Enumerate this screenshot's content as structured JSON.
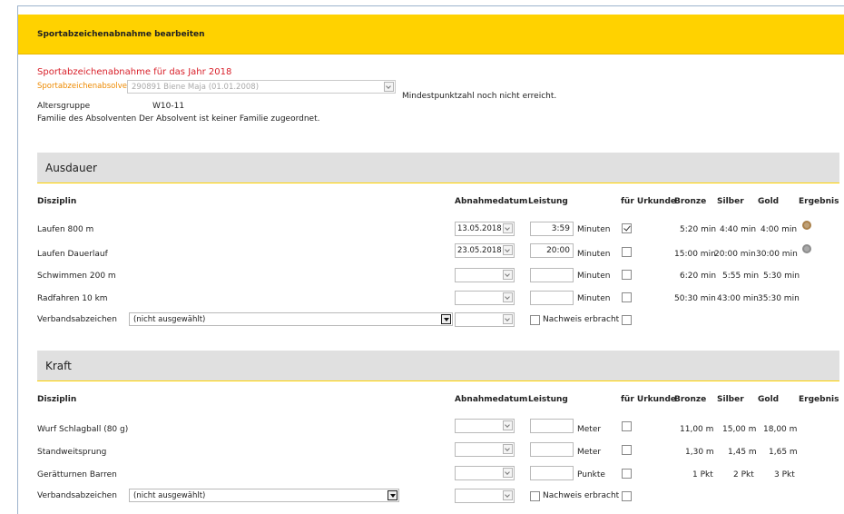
{
  "header": {
    "title": "Sportabzeichenabnahme bearbeiten"
  },
  "form": {
    "year_title": "Sportabzeichenabnahme für das Jahr 2018",
    "absolvent_label": "Sportabzeichenabsolvent",
    "absolvent_value": "290891 Biene Maja (01.01.2008)",
    "min_points_note": "Mindestpunktzahl noch nicht erreicht.",
    "age_group_label": "Altersgruppe",
    "age_group_value": "W10-11",
    "family_label": "Familie des Absolventen",
    "family_value": "Der Absolvent ist keiner Familie zugeordnet."
  },
  "columns": {
    "disziplin": "Disziplin",
    "datum": "Abnahmedatum",
    "leistung": "Leistung",
    "urkunde": "für Urkunde",
    "bronze": "Bronze",
    "silber": "Silber",
    "gold": "Gold",
    "ergebnis": "Ergebnis"
  },
  "ausdauer": {
    "title": "Ausdauer",
    "rows": [
      {
        "name": "Laufen 800 m",
        "date": "13.05.2018",
        "value": "3:59",
        "unit": "Minuten",
        "checked": true,
        "bronze": "5:20 min",
        "silber": "4:40 min",
        "gold": "4:00 min",
        "medal": "bronze"
      },
      {
        "name": "Laufen Dauerlauf",
        "date": "23.05.2018",
        "value": "20:00",
        "unit": "Minuten",
        "checked": false,
        "bronze": "15:00 min",
        "silber": "20:00 min",
        "gold": "30:00 min",
        "medal": "silver"
      },
      {
        "name": "Schwimmen 200 m",
        "date": "",
        "value": "",
        "unit": "Minuten",
        "checked": false,
        "bronze": "6:20 min",
        "silber": "5:55 min",
        "gold": "5:30 min",
        "medal": ""
      },
      {
        "name": "Radfahren 10 km",
        "date": "",
        "value": "",
        "unit": "Minuten",
        "checked": false,
        "bronze": "50:30 min",
        "silber": "43:00 min",
        "gold": "35:30 min",
        "medal": ""
      }
    ],
    "verband_label": "Verbandsabzeichen",
    "verband_value": "(nicht ausgewählt)",
    "nachweis_label": "Nachweis erbracht"
  },
  "kraft": {
    "title": "Kraft",
    "rows": [
      {
        "name": "Wurf Schlagball (80 g)",
        "date": "",
        "value": "",
        "unit": "Meter",
        "checked": false,
        "bronze": "11,00 m",
        "silber": "15,00 m",
        "gold": "18,00 m",
        "medal": ""
      },
      {
        "name": "Standweitsprung",
        "date": "",
        "value": "",
        "unit": "Meter",
        "checked": false,
        "bronze": "1,30 m",
        "silber": "1,45 m",
        "gold": "1,65 m",
        "medal": ""
      },
      {
        "name": "Gerätturnen Barren",
        "date": "",
        "value": "",
        "unit": "Punkte",
        "checked": false,
        "bronze": "1 Pkt",
        "silber": "2 Pkt",
        "gold": "3 Pkt",
        "medal": ""
      }
    ],
    "verband_label": "Verbandsabzeichen",
    "verband_value": "(nicht ausgewählt)",
    "nachweis_label": "Nachweis erbracht"
  },
  "colors": {
    "accent": "#ffd200",
    "red": "#d8202a",
    "orange": "#ee8a00",
    "section": "#e0e0e0",
    "bronze": "#a9804a",
    "silver": "#8c8c8c"
  }
}
